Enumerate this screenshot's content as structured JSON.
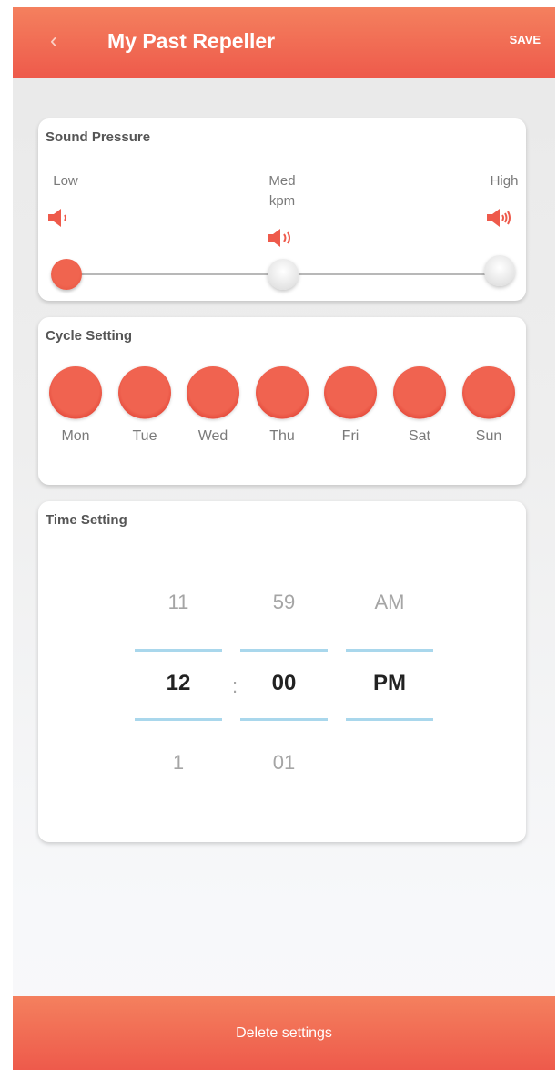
{
  "header": {
    "back_icon": "chevron-left-icon",
    "title": "My Past Repeller",
    "save_label": "SAVE"
  },
  "sound": {
    "title": "Sound Pressure",
    "levels": [
      {
        "label": "Low",
        "sub": ""
      },
      {
        "label": "Med",
        "sub": "kpm"
      },
      {
        "label": "High",
        "sub": ""
      }
    ],
    "selected": "Low",
    "accent": "#ee5a4b"
  },
  "cycle": {
    "title": "Cycle Setting",
    "days": [
      "Mon",
      "Tue",
      "Wed",
      "Thu",
      "Fri",
      "Sat",
      "Sun"
    ]
  },
  "time": {
    "title": "Time Setting",
    "hour": {
      "prev": "11",
      "selected": "12",
      "next": "1"
    },
    "minute": {
      "prev": "59",
      "selected": "00",
      "next": "01"
    },
    "period": {
      "prev": "AM",
      "selected": "PM"
    },
    "separator": ":"
  },
  "footer": {
    "delete_label": "Delete settings"
  }
}
